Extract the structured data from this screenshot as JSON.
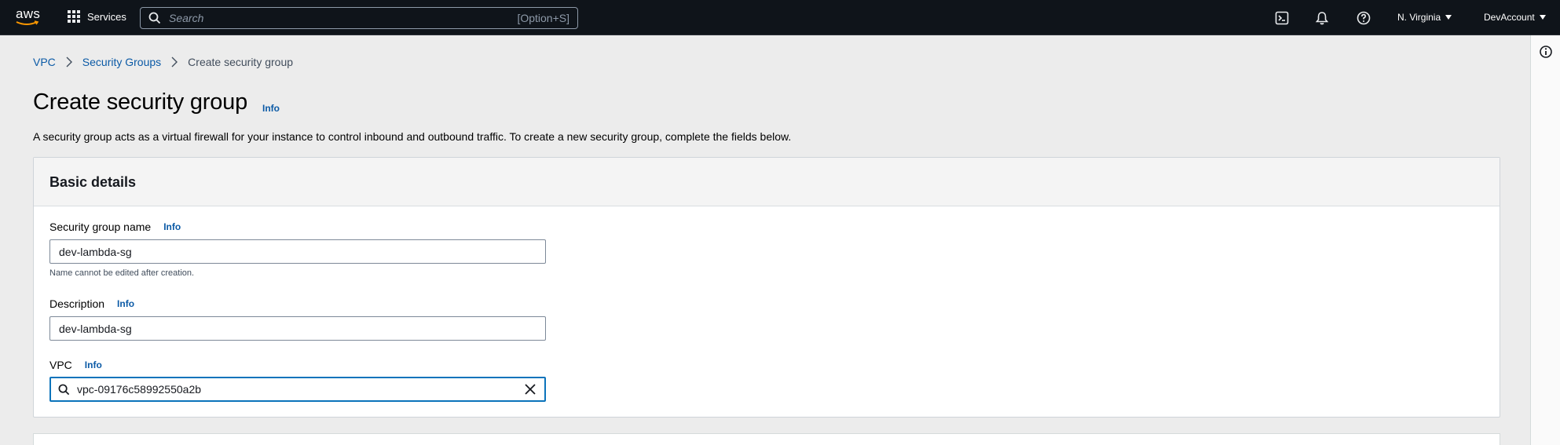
{
  "nav": {
    "logo_text": "aws",
    "services_label": "Services",
    "search_placeholder": "Search",
    "search_shortcut": "[Option+S]",
    "region_label": "N. Virginia",
    "account_label": "DevAccount",
    "icons": [
      "cloudshell-icon",
      "bell-icon",
      "help-icon"
    ]
  },
  "breadcrumb": {
    "items": [
      "VPC",
      "Security Groups"
    ],
    "current": "Create security group"
  },
  "page": {
    "title": "Create security group",
    "title_info": "Info",
    "description": "A security group acts as a virtual firewall for your instance to control inbound and outbound traffic. To create a new security group, complete the fields below."
  },
  "basic_details": {
    "heading": "Basic details",
    "name_label": "Security group name",
    "name_info": "Info",
    "name_value": "dev-lambda-sg",
    "name_hint": "Name cannot be edited after creation.",
    "desc_label": "Description",
    "desc_info": "Info",
    "desc_value": "dev-lambda-sg",
    "vpc_label": "VPC",
    "vpc_info": "Info",
    "vpc_value": "vpc-09176c58992550a2b"
  },
  "colors": {
    "nav_bg": "#0f141a",
    "link": "#0b5aa6",
    "focus_border": "#0b73bb",
    "page_bg": "#ececec"
  }
}
